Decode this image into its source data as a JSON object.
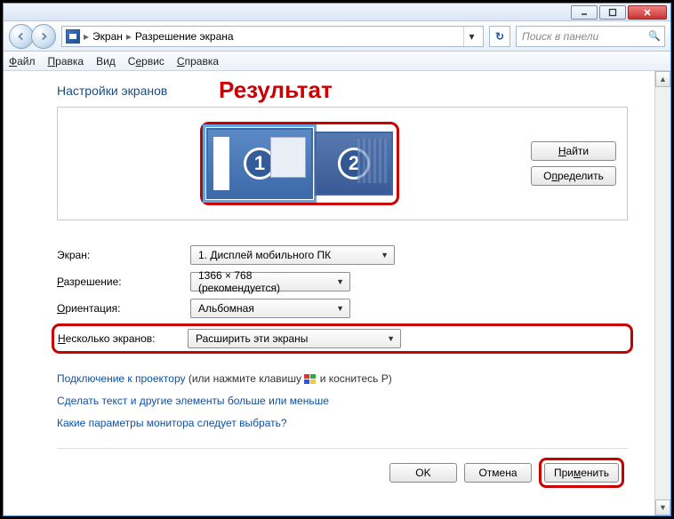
{
  "titlebar": {
    "minimize": "minimize",
    "maximize": "maximize",
    "close": "close"
  },
  "breadcrumb": {
    "item1": "Экран",
    "item2": "Разрешение экрана"
  },
  "search": {
    "placeholder": "Поиск в панели"
  },
  "menu": {
    "file": "Файл",
    "edit": "Правка",
    "view": "Вид",
    "tools": "Сервис",
    "help": "Справка"
  },
  "heading": "Настройки экранов",
  "result_overlay": "Результат",
  "monitors": {
    "m1": "1",
    "m2": "2"
  },
  "side_buttons": {
    "detect": "Найти",
    "identify": "Определить"
  },
  "labels": {
    "screen": "Экран:",
    "resolution": "Разрешение:",
    "orientation": "Ориентация:",
    "multi": "Несколько экранов:"
  },
  "values": {
    "screen": "1. Дисплей мобильного ПК",
    "resolution": "1366 × 768 (рекомендуется)",
    "orientation": "Альбомная",
    "multi": "Расширить эти экраны"
  },
  "links": {
    "projector": "Подключение к проектору",
    "projector_hint1": " (или нажмите клавишу ",
    "projector_hint2": " и коснитесь P)",
    "text_size": "Сделать текст и другие элементы больше или меньше",
    "which_monitor": "Какие параметры монитора следует выбрать?"
  },
  "footer": {
    "ok": "OK",
    "cancel": "Отмена",
    "apply": "Применить"
  }
}
